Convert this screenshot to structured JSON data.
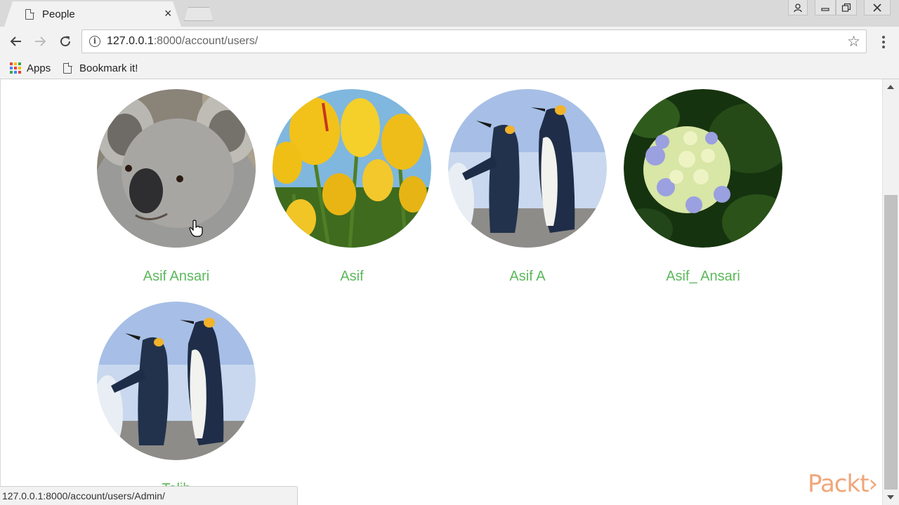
{
  "browser": {
    "tab_title": "People",
    "tab_close": "×",
    "address": {
      "host": "127.0.0.1",
      "path": ":8000/account/users/"
    },
    "bookmarks": [
      {
        "label": "Apps"
      },
      {
        "label": "Bookmark it!"
      }
    ],
    "status_url": "127.0.0.1:8000/account/users/Admin/"
  },
  "colors": {
    "name_link": "#5cb85c",
    "watermark": "#f0a67a"
  },
  "people": [
    {
      "name": "Asif Ansari",
      "avatar": "koala-photo"
    },
    {
      "name": "Asif",
      "avatar": "tulips-photo"
    },
    {
      "name": "Asif A",
      "avatar": "penguins-photo"
    },
    {
      "name": "Asif_ Ansari",
      "avatar": "hydrangea-photo"
    },
    {
      "name": "Talib",
      "avatar": "penguins-photo"
    }
  ],
  "watermark": "Packt›"
}
